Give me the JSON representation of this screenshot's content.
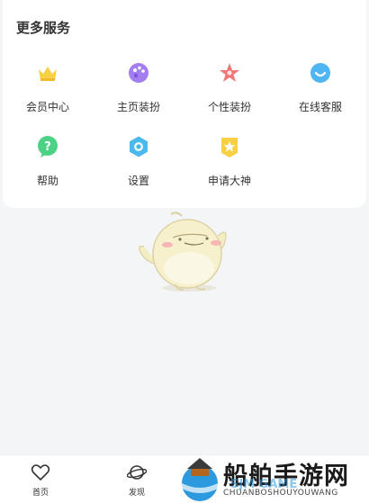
{
  "more_services": {
    "title": "更多服务",
    "items": [
      {
        "label": "会员中心",
        "icon": "crown-icon"
      },
      {
        "label": "主页装扮",
        "icon": "palette-icon"
      },
      {
        "label": "个性装扮",
        "icon": "star-icon"
      },
      {
        "label": "在线客服",
        "icon": "smile-chat-icon"
      },
      {
        "label": "帮助",
        "icon": "help-icon"
      },
      {
        "label": "设置",
        "icon": "settings-icon"
      },
      {
        "label": "申请大神",
        "icon": "badge-star-icon"
      }
    ]
  },
  "bottom_nav": {
    "items": [
      {
        "label": "首页",
        "icon": "heart-icon"
      },
      {
        "label": "发现",
        "icon": "planet-icon"
      }
    ]
  },
  "watermark": {
    "title": "船舶手游网",
    "subtitle": "CHUANBOSHOUYOUWANG",
    "logo_text": "SJM GAME"
  }
}
